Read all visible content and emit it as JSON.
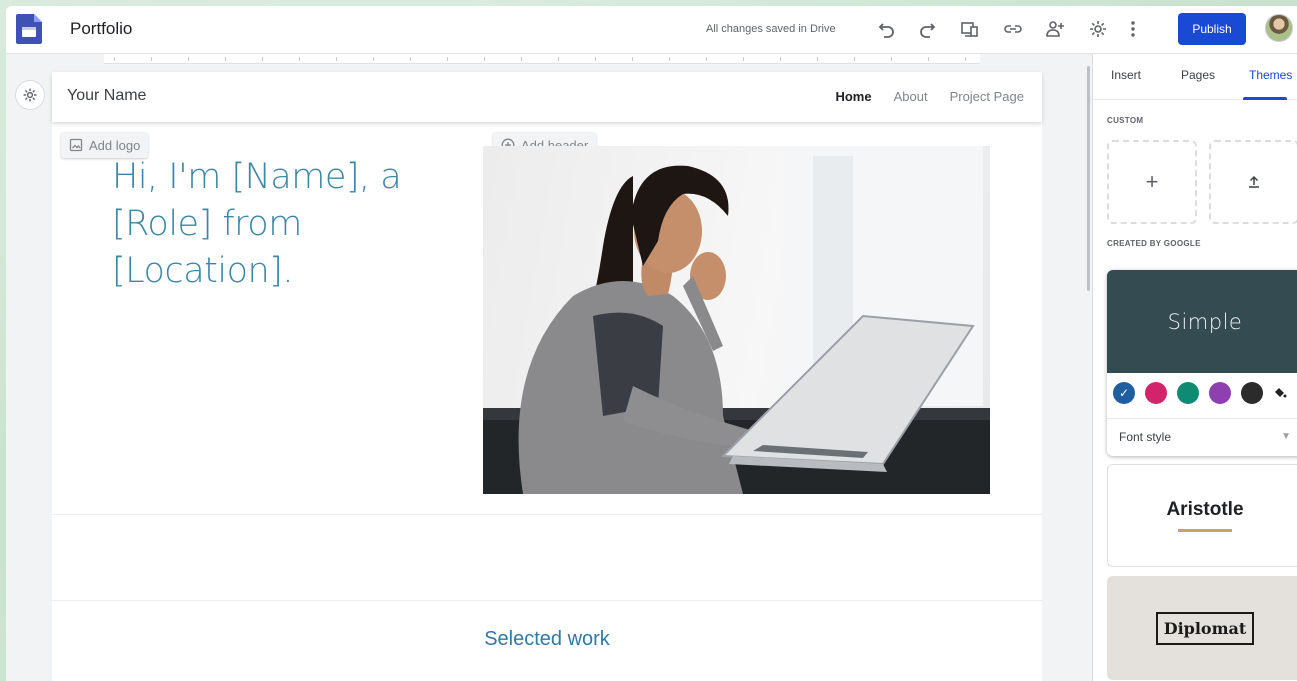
{
  "app": {
    "title": "Portfolio",
    "save_status": "All changes saved in Drive",
    "publish_label": "Publish"
  },
  "toolbar": {
    "icons": [
      "undo-icon",
      "redo-icon",
      "preview-icon",
      "link-icon",
      "share-icon",
      "gear-icon",
      "more-icon"
    ]
  },
  "site": {
    "name": "Your Name",
    "nav": [
      "Home",
      "About",
      "Project Page"
    ],
    "active_nav": "Home",
    "add_logo": "Add logo",
    "add_header": "Add header",
    "hero_text": "Hi, I'm [Name], a [Role] from [Location].",
    "section_title": "Selected work"
  },
  "panel": {
    "tabs": [
      "Insert",
      "Pages",
      "Themes"
    ],
    "active_tab": "Themes",
    "custom_heading": "CUSTOM",
    "created_heading": "CREATED BY GOOGLE",
    "custom_tiles": [
      "+",
      "upload-icon"
    ],
    "themes": {
      "simple": "Simple",
      "aristotle": "Aristotle",
      "diplomat": "Diplomat"
    },
    "swatch_colors": [
      "#1f5fa0",
      "#d3246b",
      "#0f8a73",
      "#8e3fb0",
      "#2b2b2b"
    ],
    "font_style_label": "Font style"
  },
  "colors": {
    "accent": "#1a49d4",
    "hero_text": "#3c87a6",
    "simple_header": "#344b52"
  }
}
